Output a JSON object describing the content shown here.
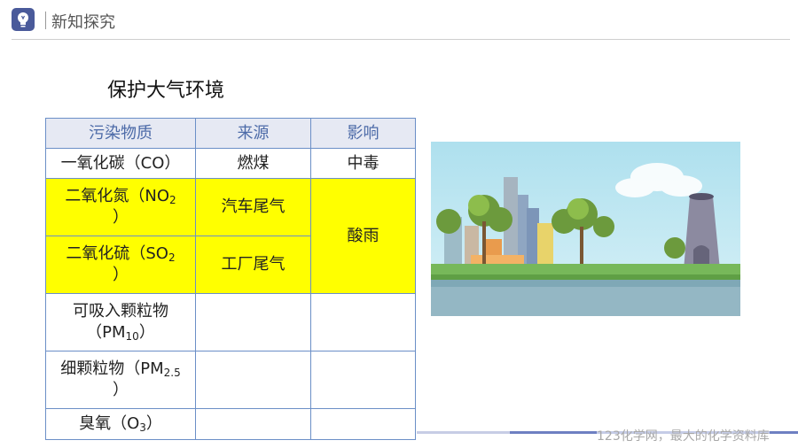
{
  "header": {
    "title": "新知探究",
    "icon": "lightbulb-icon"
  },
  "section_title": "保护大气环境",
  "table": {
    "headers": [
      "污染物质",
      "来源",
      "影响"
    ],
    "rows": {
      "co": {
        "pre": "一氧化碳（CO）",
        "source": "燃煤",
        "effect": "中毒"
      },
      "no2": {
        "pre": "二氧化氮（NO",
        "sub": "2",
        "post": "）",
        "source": "汽车尾气",
        "effect": "酸雨"
      },
      "so2": {
        "pre": "二氧化硫（SO",
        "sub": "2",
        "post": "）",
        "source": "工厂尾气"
      },
      "pm10": {
        "pre": "可吸入颗粒物",
        "pre2": "（PM",
        "sub": "10",
        "post": "）",
        "source": "",
        "effect": ""
      },
      "pm25": {
        "pre": "细颗粒物（PM",
        "sub": "2.5",
        "post": "）",
        "source": "",
        "effect": ""
      },
      "o3": {
        "pre": "臭氧（O",
        "sub": "3",
        "post": "）",
        "source": "",
        "effect": ""
      }
    }
  },
  "colors": {
    "highlight": "#ffff00",
    "border": "#6b8fc7",
    "header_text": "#4d6ba8",
    "logo": "#4a5a9a"
  },
  "watermark": "123化学网，最大的化学资料库"
}
